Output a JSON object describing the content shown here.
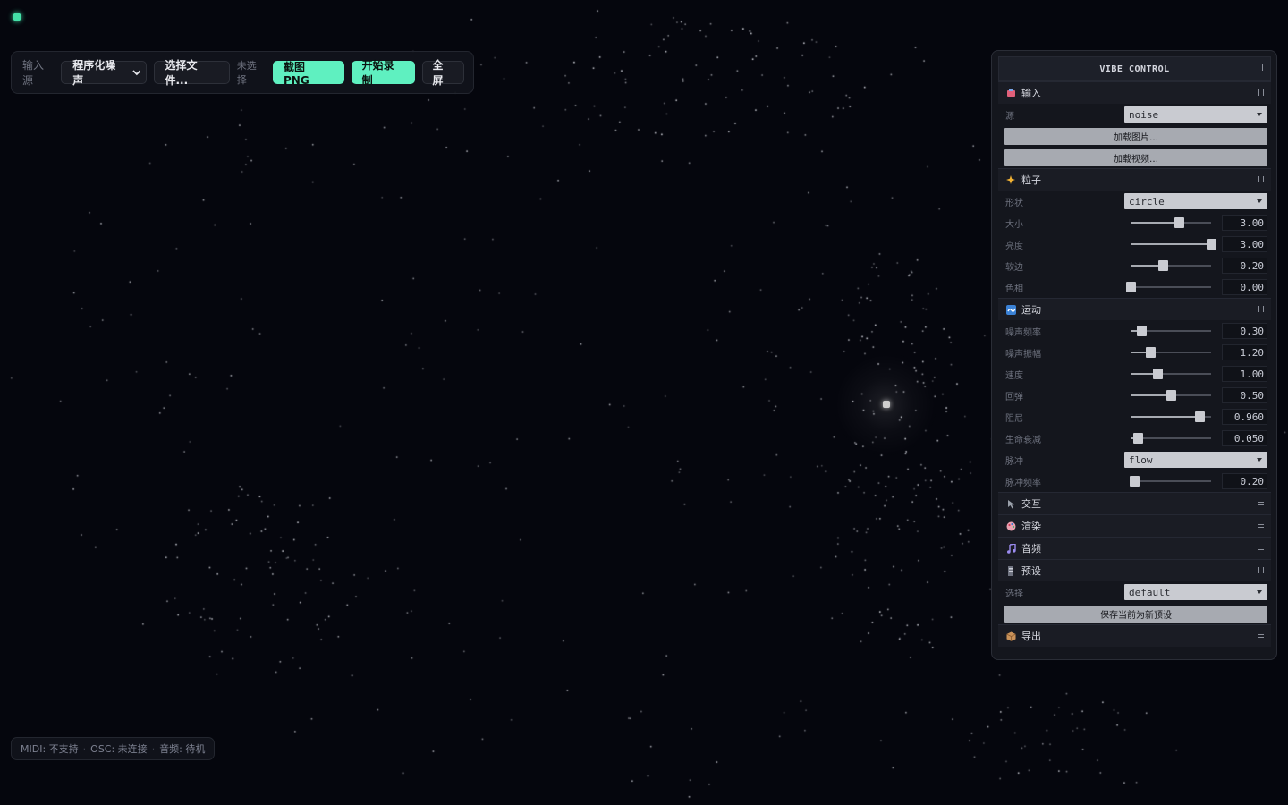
{
  "toolbar": {
    "input_source_label": "输入源",
    "source_select_value": "程序化噪声",
    "choose_file_label": "选择文件...",
    "no_file_text": "未选择",
    "screenshot_label": "截图 PNG",
    "record_label": "开始录制",
    "fullscreen_label": "全屏"
  },
  "status": {
    "midi": "MIDI: 不支持",
    "osc": "OSC: 未连接",
    "audio": "音频: 待机",
    "separator": "·"
  },
  "panel": {
    "title": "VIBE CONTROL",
    "input": {
      "title": "输入",
      "icon": "video-camera-icon",
      "source_label": "源",
      "source_value": "noise",
      "load_image_label": "加载图片…",
      "load_video_label": "加载视频…"
    },
    "particles": {
      "title": "粒子",
      "icon": "sparkles-icon",
      "shape_label": "形状",
      "shape_value": "circle",
      "size_label": "大小",
      "size_value": "3.00",
      "size_fraction": 0.6,
      "brightness_label": "亮度",
      "brightness_value": "3.00",
      "brightness_fraction": 1.0,
      "softness_label": "软边",
      "softness_value": "0.20",
      "softness_fraction": 0.4,
      "hue_label": "色相",
      "hue_value": "0.00",
      "hue_fraction": 0.0
    },
    "motion": {
      "title": "运动",
      "icon": "wave-icon",
      "noise_freq_label": "噪声频率",
      "noise_freq_value": "0.30",
      "noise_freq_fraction": 0.13,
      "noise_amp_label": "噪声振幅",
      "noise_amp_value": "1.20",
      "noise_amp_fraction": 0.24,
      "speed_label": "速度",
      "speed_value": "1.00",
      "speed_fraction": 0.33,
      "spring_label": "回弹",
      "spring_value": "0.50",
      "spring_fraction": 0.5,
      "damping_label": "阻尼",
      "damping_value": "0.960",
      "damping_fraction": 0.85,
      "life_decay_label": "生命衰减",
      "life_decay_value": "0.050",
      "life_decay_fraction": 0.09,
      "pulse_label": "脉冲",
      "pulse_value": "flow",
      "pulse_freq_label": "脉冲频率",
      "pulse_freq_value": "0.20",
      "pulse_freq_fraction": 0.04
    },
    "interaction": {
      "title": "交互",
      "icon": "pointer-icon"
    },
    "render": {
      "title": "渲染",
      "icon": "palette-icon"
    },
    "audio": {
      "title": "音频",
      "icon": "music-note-icon"
    },
    "presets": {
      "title": "预设",
      "icon": "bookmark-icon",
      "select_label": "选择",
      "select_value": "default",
      "save_label": "保存当前为新预设"
    },
    "export": {
      "title": "导出",
      "icon": "package-icon"
    }
  },
  "colors": {
    "background": "#05060d",
    "accent": "#5ff0c0",
    "status_dot": "#44e0a8"
  }
}
